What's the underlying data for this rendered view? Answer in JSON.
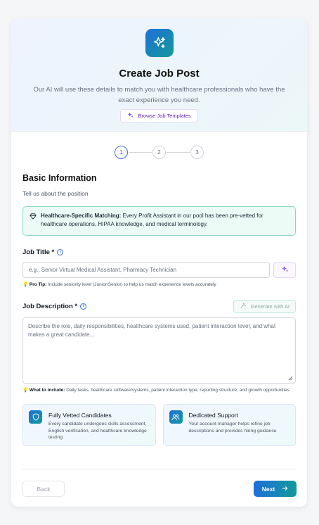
{
  "header": {
    "title": "Create Job Post",
    "subtitle": "Our AI will use these details to match you with healthcare professionals who have the exact experience you need.",
    "templates_button": "Browse Job Templates"
  },
  "steps": [
    "1",
    "2",
    "3"
  ],
  "active_step": 1,
  "section": {
    "title": "Basic Information",
    "subtitle": "Tell us about the position"
  },
  "notice": {
    "bold": "Healthcare-Specific Matching:",
    "text": " Every Profit Assistant in our pool has been pre-vetted for healthcare operations, HIPAA knowledge, and medical terminology."
  },
  "job_title": {
    "label": "Job Title *",
    "placeholder": "e.g., Senior Virtual Medical Assistant, Pharmacy Technician",
    "tip_bold": "Pro Tip:",
    "tip_text": " Include seniority level (Junior/Senior) to help us match experience levels accurately"
  },
  "job_description": {
    "label": "Job Description *",
    "generate_button": "Generate with AI",
    "placeholder": "Describe the role, daily responsibilities, healthcare systems used, patient interaction level, and what makes a great candidate...",
    "tip_bold": "What to include:",
    "tip_text": " Daily tasks, healthcare software/systems, patient interaction type, reporting structure, and growth opportunities"
  },
  "features": [
    {
      "title": "Fully Vetted Candidates",
      "text": "Every candidate undergoes skills assessment, English verification, and healthcare knowledge testing",
      "icon": "shield-icon"
    },
    {
      "title": "Dedicated Support",
      "text": "Your account manager helps refine job descriptions and provides hiring guidance",
      "icon": "users-icon"
    }
  ],
  "footer": {
    "back": "Back",
    "next": "Next"
  },
  "colors": {
    "accent_blue": "#1e6fd9",
    "accent_teal": "#139a9a",
    "purple": "#5b21b6"
  }
}
